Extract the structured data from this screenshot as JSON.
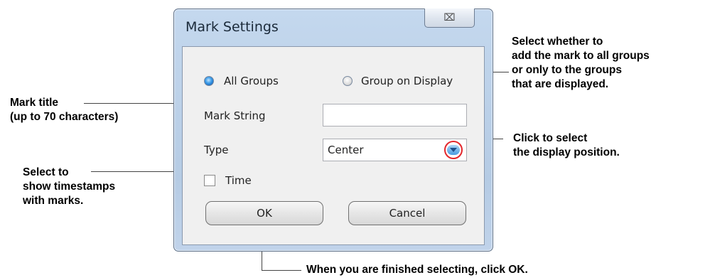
{
  "dialog": {
    "title": "Mark Settings",
    "close_glyph": "⌧",
    "radio_all_groups": {
      "label": "All Groups",
      "selected": true
    },
    "radio_group_on_display": {
      "label": "Group on Display",
      "selected": false
    },
    "mark_string": {
      "label": "Mark String",
      "value": ""
    },
    "type": {
      "label": "Type",
      "selected": "Center"
    },
    "time": {
      "label": "Time",
      "checked": false
    },
    "ok_label": "OK",
    "cancel_label": "Cancel"
  },
  "callouts": {
    "mark_title": [
      "Mark title",
      "(up to 70 characters)"
    ],
    "timestamps": [
      "Select to",
      "show timestamps",
      "with marks."
    ],
    "groups": [
      "Select whether to",
      "add the mark to all groups",
      "or only to the groups",
      "that are displayed."
    ],
    "display_position": [
      "Click to select",
      "the display position."
    ],
    "finished": "When you are finished selecting, click OK."
  },
  "colors": {
    "highlight_circle": "#e3262b",
    "radio_selected": "#3a9be8",
    "window_frame": "#b5cbe4"
  },
  "icons": {
    "close": "close-icon",
    "dropdown": "chevron-down-icon"
  }
}
